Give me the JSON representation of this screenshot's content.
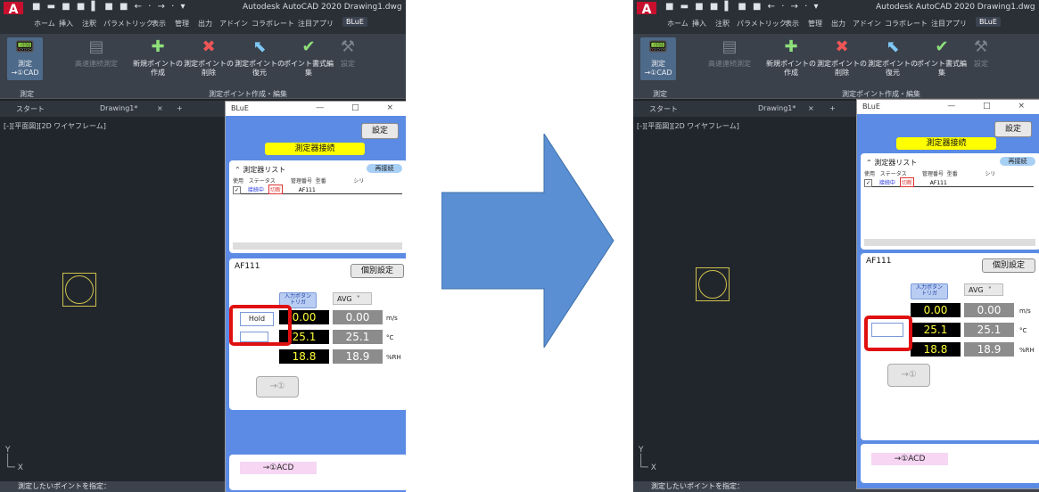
{
  "app": {
    "title": "Autodesk AutoCAD 2020   Drawing1.dwg",
    "quick_access": "■ ▬ ■ ■ ▌ ■ ■ ← · → · ▾"
  },
  "ribbon_tabs": [
    "ホーム",
    "挿入",
    "注釈",
    "パラメトリック",
    "表示",
    "管理",
    "出力",
    "アドイン",
    "コラボレート",
    "注目アプリ",
    "BLuE"
  ],
  "ribbon": {
    "measure_label": "測定\n→①CAD",
    "highspeed_label": "高速連続測定",
    "new_point": "新規ポイントの作成",
    "delete_point": "測定ポイントの削除",
    "restore_point": "測定ポイントの復元",
    "format_edit": "ポイント書式編集",
    "settings": "設定",
    "panel_measure": "測定",
    "panel_points": "測定ポイント作成・編集"
  },
  "doc_tabs": {
    "start": "スタート",
    "drawing": "Drawing1*",
    "close": "×",
    "add": "+"
  },
  "viewport_label": "[-][平面図][2D ワイヤフレーム]",
  "command_line": "測定したいポイントを指定：",
  "blue": {
    "window_title": "BLuE",
    "window_controls": "—  □  ×",
    "settings_button": "設定",
    "connect_button": "測定器接続",
    "device_list_title": "測定器リスト",
    "reconnect": "再接続",
    "columns": [
      "使用",
      "ステータス",
      "管理番号",
      "型番",
      "シリ"
    ],
    "row": {
      "checked": "✓",
      "status": "接続中",
      "disconnect": "切断",
      "model": "AF111"
    },
    "device_name": "AF111",
    "individual_settings": "個別設定",
    "trigger": "入力ボタン\nトリガ",
    "avg": "AVG",
    "avg_arrow": "˅",
    "hold": "Hold",
    "values": [
      {
        "live": "0.00",
        "avg": "0.00",
        "unit": "m/s"
      },
      {
        "live": "25.1",
        "avg": "25.1",
        "unit": "°C"
      },
      {
        "live": "18.8",
        "avg": "18.9",
        "unit": "%RH"
      }
    ],
    "send_button": "→①",
    "acd_label": "→①ACD"
  }
}
